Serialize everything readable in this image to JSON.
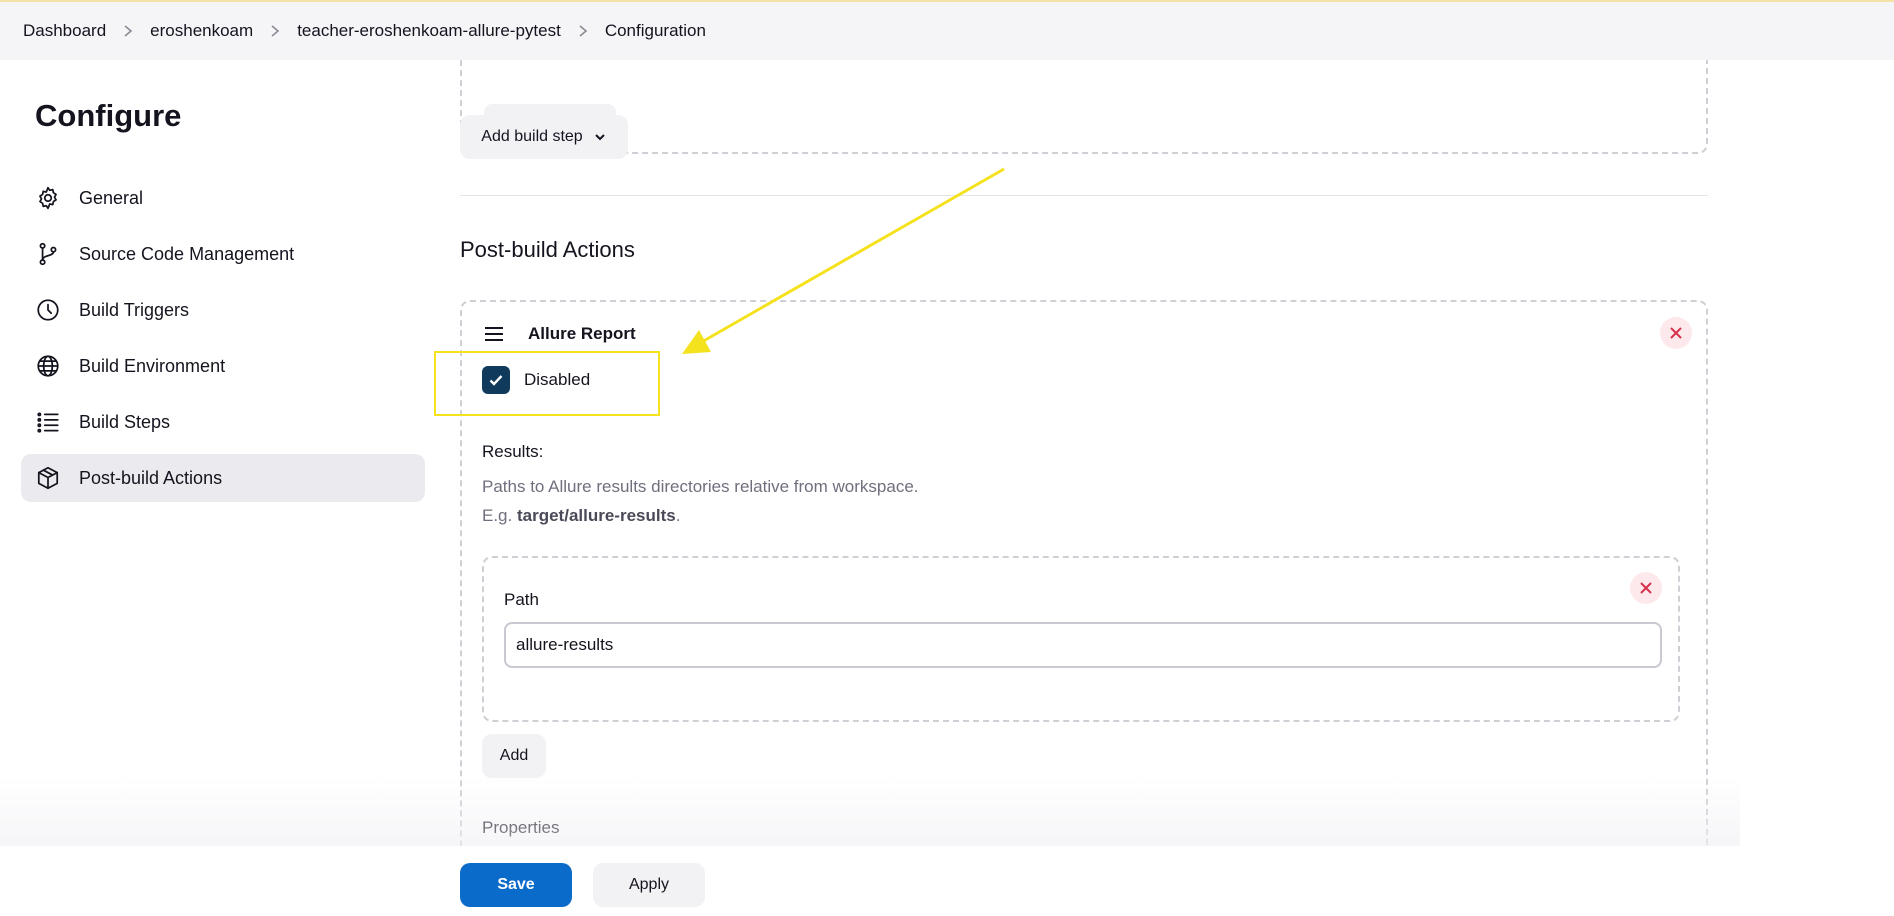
{
  "breadcrumb": [
    "Dashboard",
    "eroshenkoam",
    "teacher-eroshenkoam-allure-pytest",
    "Configuration"
  ],
  "sidebar": {
    "title": "Configure",
    "items": [
      {
        "label": "General",
        "icon": "gear-icon"
      },
      {
        "label": "Source Code Management",
        "icon": "branch-icon"
      },
      {
        "label": "Build Triggers",
        "icon": "clock-icon"
      },
      {
        "label": "Build Environment",
        "icon": "globe-icon"
      },
      {
        "label": "Build Steps",
        "icon": "list-icon"
      },
      {
        "label": "Post-build Actions",
        "icon": "package-icon",
        "active": true
      }
    ]
  },
  "main": {
    "add_build_step": "Add build step",
    "post_build_title": "Post-build Actions",
    "allure": {
      "title": "Allure Report",
      "disabled_label": "Disabled",
      "disabled_checked": true,
      "results_label": "Results:",
      "help_line1": "Paths to Allure results directories relative from workspace.",
      "help_eg": "E.g.",
      "help_example": "target/allure-results",
      "help_end": ".",
      "path_label": "Path",
      "path_value": "allure-results",
      "add_label": "Add",
      "properties_label": "Properties"
    }
  },
  "footer": {
    "save": "Save",
    "apply": "Apply"
  },
  "colors": {
    "accent": "#0b6bcb",
    "checkbox": "#0f3a5c",
    "highlight": "#f5e21f"
  }
}
